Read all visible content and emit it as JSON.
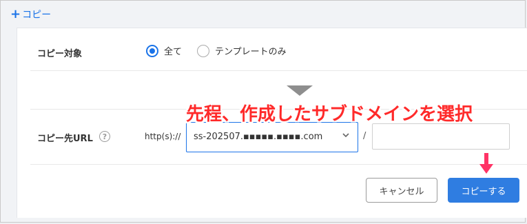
{
  "panel": {
    "header_plus": "+",
    "header_label": "コピー"
  },
  "copy_target": {
    "label": "コピー対象",
    "options": [
      {
        "label": "全て",
        "checked": true
      },
      {
        "label": "テンプレートのみ",
        "checked": false
      }
    ]
  },
  "annotation": {
    "text": "先程、作成したサブドメインを選択",
    "color": "#ff2a2a"
  },
  "copy_dest": {
    "label": "コピー先URL",
    "help_icon": "question-circle-icon",
    "help_glyph": "?",
    "protocol": "http(s)://",
    "selected_domain": "ss-202507.▪▪▪▪▪.▪▪▪▪.com",
    "separator": "/",
    "path_value": ""
  },
  "actions": {
    "cancel_label": "キャンセル",
    "copy_label": "コピーする"
  },
  "colors": {
    "accent": "#1a73e8",
    "button_primary": "#2f7de1",
    "arrow": "#ff3366"
  }
}
